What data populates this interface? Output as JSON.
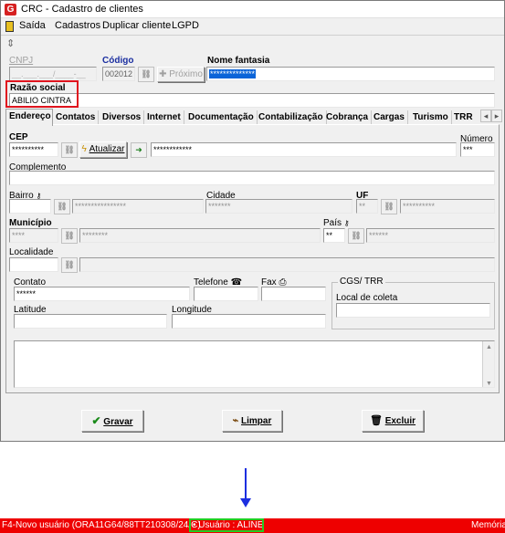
{
  "window": {
    "title": "CRC - Cadastro de clientes",
    "icon": "app-logo-icon"
  },
  "menu": [
    "Saída",
    "Cadastros",
    "Duplicar cliente",
    "LGPD"
  ],
  "header": {
    "cnpj_label": "CNPJ",
    "cnpj_mask": "__.___.___/____-__",
    "codigo_label": "Código",
    "codigo_value": "002012",
    "proximo_label": "Próximo",
    "nome_fantasia_label": "Nome fantasia",
    "nome_fantasia_value": "**************",
    "razao_social_label": "Razão social",
    "razao_social_value": "ABILIO CINTRA"
  },
  "tabs": [
    "Endereço",
    "Contatos",
    "Diversos",
    "Internet",
    "Documentação",
    "Contabilização",
    "Cobrança",
    "Cargas",
    "Turismo",
    "TRR"
  ],
  "endereco": {
    "cep_label": "CEP",
    "cep_value": "**********",
    "atualizar_label": "Atualizar",
    "logradouro_value": "************",
    "numero_label": "Número",
    "numero_value": "***",
    "complemento_label": "Complemento",
    "bairro_label": "Bairro",
    "bairro_code": "",
    "bairro_value": "****************",
    "cidade_label": "Cidade",
    "cidade_value": "*******",
    "uf_label": "UF",
    "uf_value": "**",
    "uf_name": "**********",
    "municipio_label": "Município",
    "municipio_code": "****",
    "municipio_value": "********",
    "pais_label": "País",
    "pais_code": "**",
    "pais_value": "******",
    "localidade_label": "Localidade",
    "contato_label": "Contato",
    "contato_value": "******",
    "telefone_label": "Telefone",
    "fax_label": "Fax",
    "cgs_trr_label": "CGS/ TRR",
    "local_coleta_label": "Local de coleta",
    "latitude_label": "Latitude",
    "longitude_label": "Longitude"
  },
  "actions": {
    "gravar": "Gravar",
    "limpar": "Limpar",
    "excluir": "Excluir"
  },
  "status": {
    "novo_usuario": "F4-Novo usuário (ORA11G64/88TT210308/24/C)",
    "usuario": "Usuário : ALINE",
    "memoria": "Memória"
  },
  "colors": {
    "status_bar": "#ee0000",
    "highlight_red": "#e0141e",
    "highlight_green": "#22cc22",
    "arrow": "#1c2ee0",
    "selection": "#0a64d8"
  }
}
